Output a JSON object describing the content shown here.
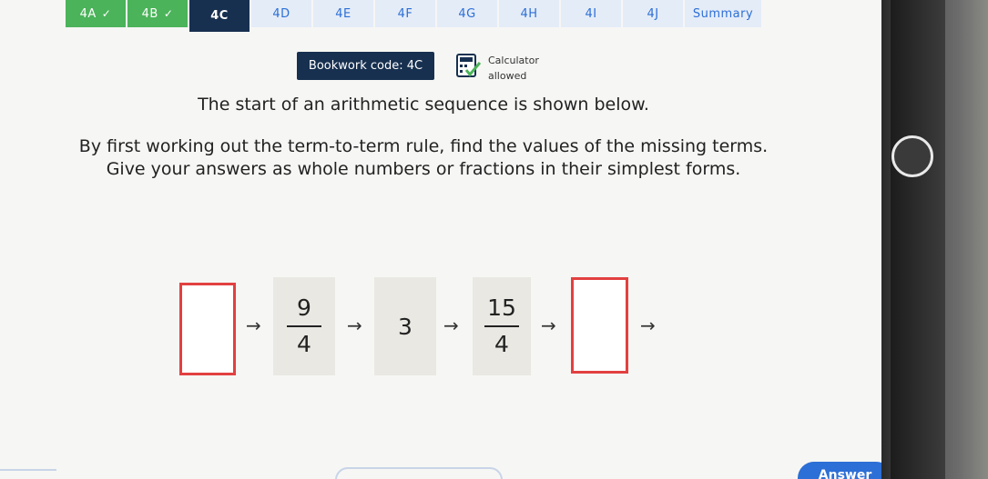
{
  "tabs": [
    {
      "label": "4A",
      "done": true
    },
    {
      "label": "4B",
      "done": true
    },
    {
      "label": "4C",
      "active": true
    },
    {
      "label": "4D"
    },
    {
      "label": "4E"
    },
    {
      "label": "4F"
    },
    {
      "label": "4G"
    },
    {
      "label": "4H"
    },
    {
      "label": "4I"
    },
    {
      "label": "4J"
    },
    {
      "label": "Summary"
    }
  ],
  "check_glyph": "✓",
  "bookwork": "Bookwork code: 4C",
  "calculator": {
    "line1": "Calculator",
    "line2": "allowed",
    "icon": "calculator-check-icon"
  },
  "question": {
    "intro": "The start of an arithmetic sequence is shown below.",
    "line1": "By first working out the term-to-term rule, find the values of the missing terms.",
    "line2": "Give your answers as whole numbers or fractions in their simplest forms."
  },
  "sequence": {
    "term2": {
      "num": "9",
      "den": "4"
    },
    "term3": "3",
    "term4": {
      "num": "15",
      "den": "4"
    },
    "arrow": "→"
  },
  "answer_button": "Answer",
  "colors": {
    "accent": "#2c6fd6",
    "done": "#4bb35a",
    "navy": "#173050",
    "answer_border": "#e24040"
  }
}
